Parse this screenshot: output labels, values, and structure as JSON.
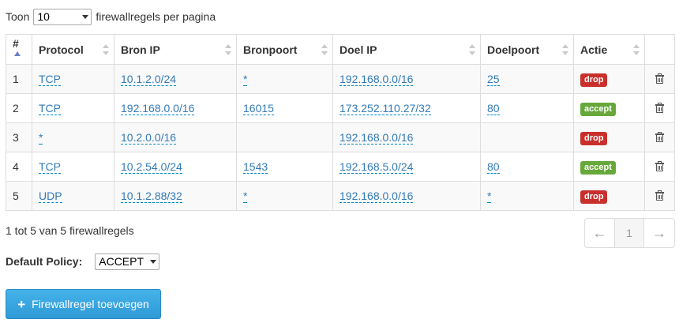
{
  "length_menu": {
    "prefix": "Toon",
    "value": "10",
    "suffix": "firewallregels per pagina"
  },
  "table": {
    "columns": [
      "#",
      "Protocol",
      "Bron IP",
      "Bronpoort",
      "Doel IP",
      "Doelpoort",
      "Actie",
      ""
    ],
    "rows": [
      {
        "num": "1",
        "protocol": "TCP",
        "src_ip": "10.1.2.0/24",
        "src_port": "*",
        "dst_ip": "192.168.0.0/16",
        "dst_port": "25",
        "action": "drop"
      },
      {
        "num": "2",
        "protocol": "TCP",
        "src_ip": "192.168.0.0/16",
        "src_port": "16015",
        "dst_ip": "173.252.110.27/32",
        "dst_port": "80",
        "action": "accept"
      },
      {
        "num": "3",
        "protocol": "*",
        "src_ip": "10.2.0.0/16",
        "src_port": "",
        "dst_ip": "192.168.0.0/16",
        "dst_port": "",
        "action": "drop"
      },
      {
        "num": "4",
        "protocol": "TCP",
        "src_ip": "10.2.54.0/24",
        "src_port": "1543",
        "dst_ip": "192.168.5.0/24",
        "dst_port": "80",
        "action": "accept"
      },
      {
        "num": "5",
        "protocol": "UDP",
        "src_ip": "10.1.2.88/32",
        "src_port": "*",
        "dst_ip": "192.168.0.0/16",
        "dst_port": "*",
        "action": "drop"
      }
    ]
  },
  "info_text": "1 tot 5 van 5 firewallregels",
  "pagination": {
    "prev": "←",
    "current": "1",
    "next": "→"
  },
  "policy": {
    "label": "Default Policy:",
    "value": "ACCEPT"
  },
  "add_button": {
    "icon": "plus-icon",
    "label": "Firewallregel toevoegen"
  },
  "colors": {
    "drop": "#c9302c",
    "accept": "#67a83b",
    "link": "#337ab7",
    "button": "#3ba8e0"
  }
}
